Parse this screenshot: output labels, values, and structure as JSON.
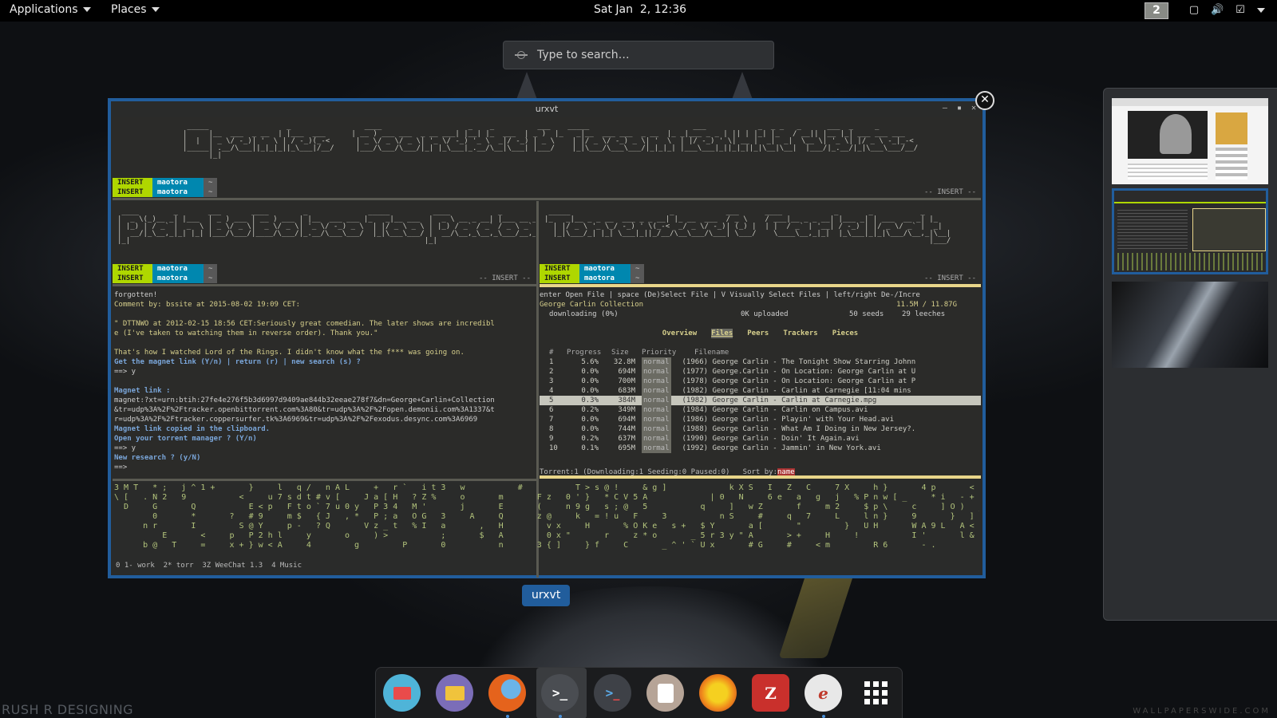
{
  "topbar": {
    "applications": "Applications",
    "places": "Places",
    "clock": "Sat Jan  2, 12:36",
    "workspace_badge": "2"
  },
  "search": {
    "placeholder": "Type to search…"
  },
  "window": {
    "title": "urxvt",
    "label": "urxvt"
  },
  "panes": {
    "top": {
      "modes": [
        "INSERT",
        "INSERT"
      ],
      "user": [
        "maotora",
        "maotora"
      ],
      "tilde": [
        "~",
        "~"
      ],
      "indicator": "-- INSERT --"
    },
    "left": {
      "modes": [
        "INSERT",
        "INSERT"
      ],
      "user": [
        "maotora",
        "maotora"
      ],
      "tilde": [
        "~",
        "~"
      ],
      "indicator": "-- INSERT --"
    },
    "right": {
      "modes": [
        "INSERT",
        "INSERT"
      ],
      "user": [
        "maotora",
        "maotora"
      ],
      "tilde": [
        "~",
        "~"
      ],
      "indicator": "-- INSERT --"
    }
  },
  "chat": {
    "lines": [
      {
        "t": "forgotten!",
        "c": "w"
      },
      {
        "t": "Comment by: bssite at 2015-08-02 19:09 CET:",
        "c": "y"
      },
      {
        "t": "",
        "c": "w"
      },
      {
        "t": "\" DTTNWO at 2012-02-15 18:56 CET:Seriously great comedian. The later shows are incredibl",
        "c": "y"
      },
      {
        "t": "e (I've taken to watching them in reverse order). Thank you.\"",
        "c": "y"
      },
      {
        "t": "",
        "c": "w"
      },
      {
        "t": "That's how I watched Lord of the Rings. I didn't know what the f*** was going on.",
        "c": "y"
      },
      {
        "t": "Get the magnet link (Y/n) | return (r) | new search (s) ?",
        "c": "b"
      },
      {
        "t": "==> y",
        "c": "w"
      },
      {
        "t": "",
        "c": "w"
      },
      {
        "t": "Magnet link :",
        "c": "b"
      },
      {
        "t": "magnet:?xt=urn:btih:27fe4e276f5b3d6997d9409ae844b32eeae278f7&dn=George+Carlin+Collection",
        "c": "w"
      },
      {
        "t": "&tr=udp%3A%2F%2Ftracker.openbittorrent.com%3A80&tr=udp%3A%2F%2Fopen.demonii.com%3A1337&t",
        "c": "w"
      },
      {
        "t": "r=udp%3A%2F%2Ftracker.coppersurfer.tk%3A6969&tr=udp%3A%2F%2Fexodus.desync.com%3A6969",
        "c": "w"
      },
      {
        "t": "Magnet link copied in the clipboard.",
        "c": "b"
      },
      {
        "t": "Open your torrent manager ? (Y/n)",
        "c": "b"
      },
      {
        "t": "==> y",
        "c": "w"
      },
      {
        "t": "New research ? (y/N)",
        "c": "b"
      },
      {
        "t": "==>",
        "c": "w"
      }
    ]
  },
  "torrent": {
    "help": "enter Open File | space (De)Select File | V Visually Select Files | left/right De-/Incre",
    "name": "George Carlin Collection",
    "size": "11.5M / 11.87G",
    "state": "downloading (0%)",
    "uploaded": "0K uploaded",
    "seeds": "50 seeds",
    "leeches": "29 leeches",
    "tabs": [
      "Overview",
      "Files",
      "Peers",
      "Trackers",
      "Pieces"
    ],
    "headers": [
      "#",
      "Progress",
      "Size",
      "Priority",
      "Filename"
    ],
    "rows": [
      [
        "1",
        "5.6%",
        "32.8M",
        "normal",
        "(1966) George Carlin - The Tonight Show Starring Johnn"
      ],
      [
        "2",
        "0.0%",
        "694M",
        "normal",
        "(1977) George.Carlin - On Location: George Carlin at U"
      ],
      [
        "3",
        "0.0%",
        "700M",
        "normal",
        "(1978) George Carlin - On Location: George Carlin at P"
      ],
      [
        "4",
        "0.0%",
        "683M",
        "normal",
        "(1982) George Carlin - Carlin at Carnegie [11:04 mins"
      ],
      [
        "5",
        "0.3%",
        "384M",
        "normal",
        "(1982) George Carlin - Carlin at Carnegie.mpg"
      ],
      [
        "6",
        "0.2%",
        "349M",
        "normal",
        "(1984) George Carlin - Carlin on Campus.avi"
      ],
      [
        "7",
        "0.0%",
        "694M",
        "normal",
        "(1986) George Carlin - Playin' with Your Head.avi"
      ],
      [
        "8",
        "0.0%",
        "744M",
        "normal",
        "(1988) George Carlin - What Am I Doing in New Jersey?."
      ],
      [
        "9",
        "0.2%",
        "637M",
        "normal",
        "(1990) George Carlin - Doin' It Again.avi"
      ],
      [
        "10",
        "0.1%",
        "695M",
        "normal",
        "(1992) George Carlin - Jammin' in New York.avi"
      ]
    ],
    "footer": "Torrent:1 (Downloading:1 Seeding:0 Paused:0)   Sort by:",
    "sort": "name"
  },
  "tmux": {
    "status": "0 1- work  2* torr  3Z WeeChat 1.3  4 Music"
  },
  "dock": {
    "items": [
      "mail-icon",
      "files-icon",
      "firefox-icon",
      "terminal-icon",
      "terminal2-icon",
      "contacts-icon",
      "torrent-icon",
      "zotero-icon",
      "reader-icon",
      "app-grid-icon"
    ]
  },
  "watermark": "RUSH R DESIGNING",
  "watermark_right": "WALLPAPERSWIDE.COM",
  "colors": {
    "accent": "#215d9c",
    "insert": "#afd700",
    "user": "#0087af"
  }
}
